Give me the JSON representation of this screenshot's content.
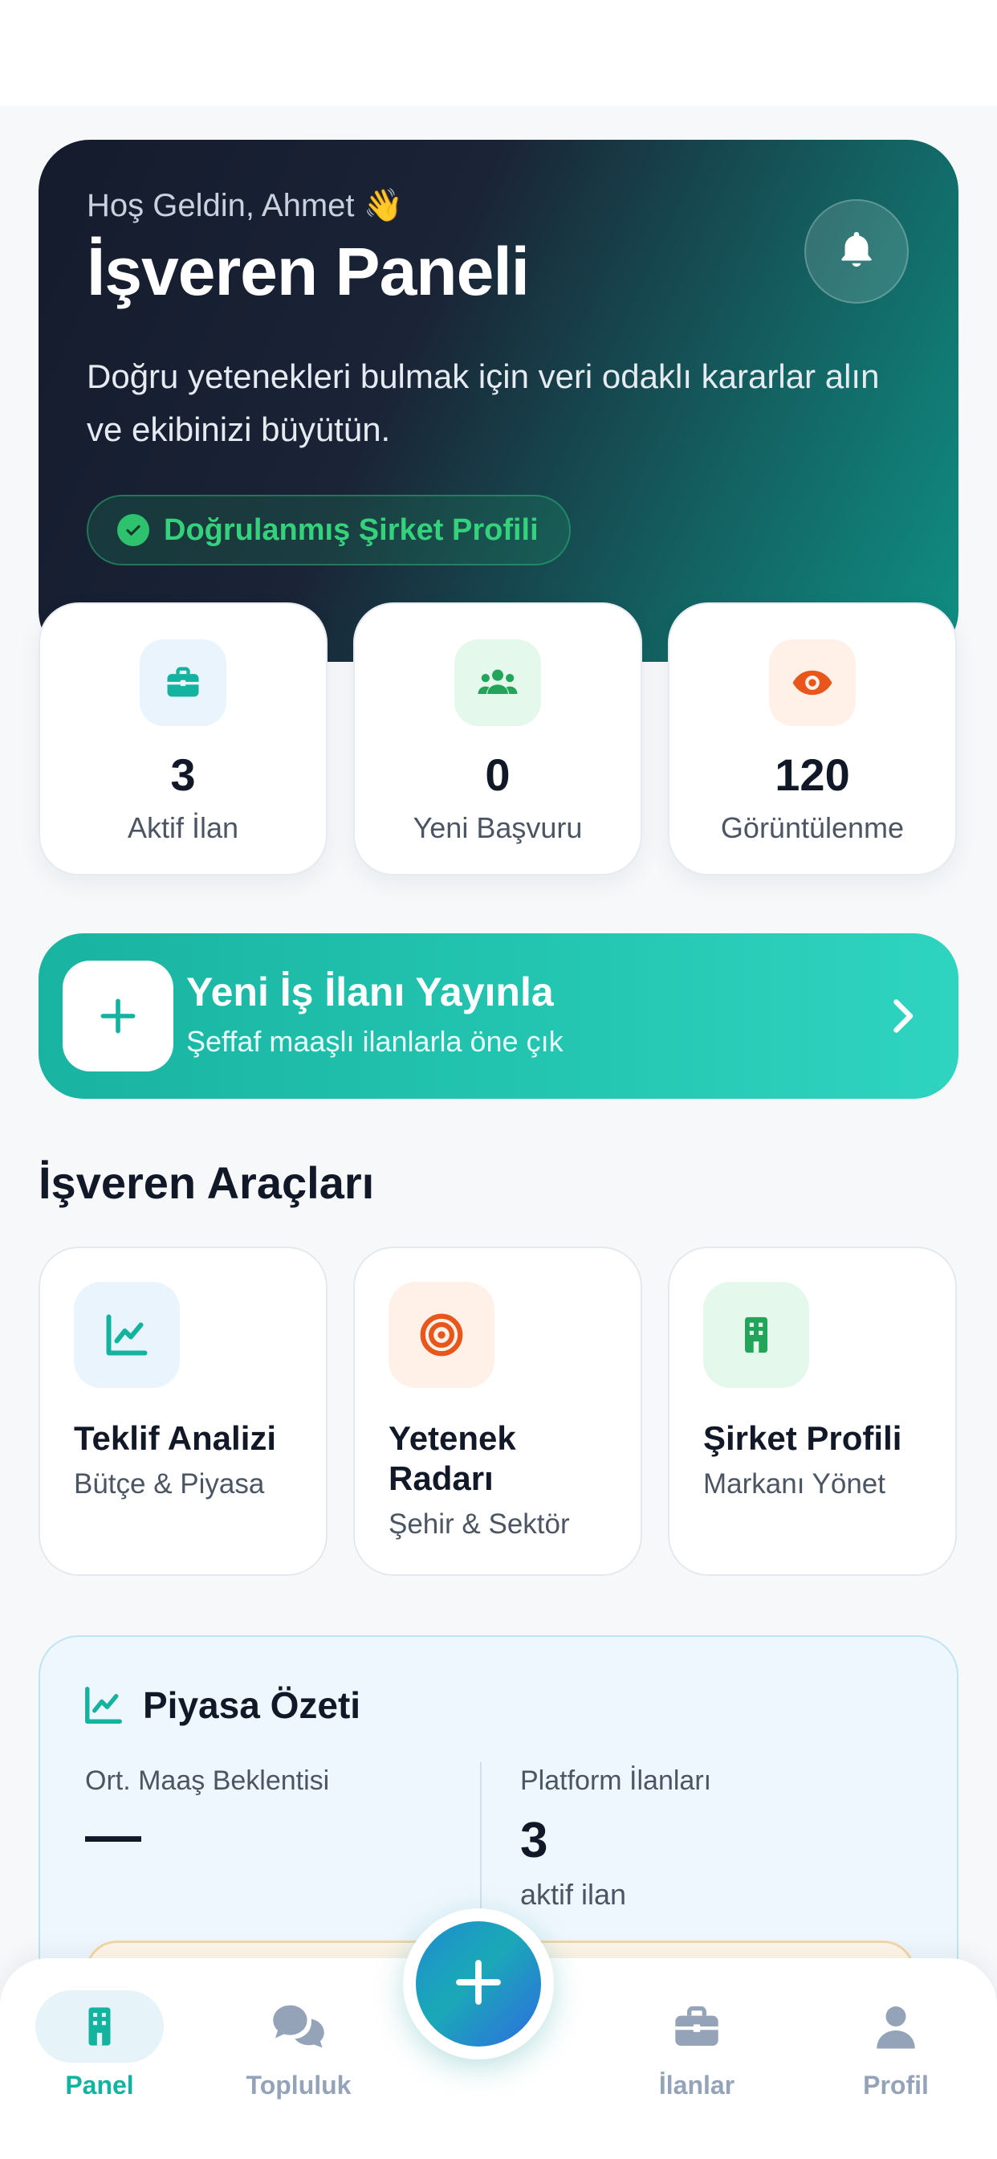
{
  "hero": {
    "greeting": "Hoş Geldin, Ahmet 👋",
    "title": "İşveren Paneli",
    "description": "Doğru yetenekleri bulmak için veri odaklı kararlar alın ve ekibinizi büyütün.",
    "verified_badge": "Doğrulanmış Şirket Profili"
  },
  "stats": [
    {
      "value": "3",
      "label": "Aktif İlan",
      "icon": "briefcase-icon",
      "color": "#14b3a0"
    },
    {
      "value": "0",
      "label": "Yeni Başvuru",
      "icon": "users-icon",
      "color": "#22a55a"
    },
    {
      "value": "120",
      "label": "Görüntülenme",
      "icon": "eye-icon",
      "color": "#e8561c"
    }
  ],
  "cta": {
    "title": "Yeni İş İlanı Yayınla",
    "subtitle": "Şeffaf maaşlı ilanlarla öne çık"
  },
  "tools_section": {
    "title": "İşveren Araçları",
    "items": [
      {
        "title": "Teklif Analizi",
        "subtitle": "Bütçe & Piyasa",
        "icon": "chart-line-icon"
      },
      {
        "title": "Yetenek Radarı",
        "subtitle": "Şehir & Sektör",
        "icon": "target-icon"
      },
      {
        "title": "Şirket Profili",
        "subtitle": "Markanı Yönet",
        "icon": "building-icon"
      }
    ]
  },
  "market": {
    "title": "Piyasa Özeti",
    "salary_label": "Ort. Maaş Beklentisi",
    "salary_value": "—",
    "listings_label": "Platform İlanları",
    "listings_value": "3",
    "listings_sub": "aktif ilan"
  },
  "tabbar": {
    "items": [
      {
        "label": "Panel",
        "icon": "building-icon",
        "active": true
      },
      {
        "label": "Topluluk",
        "icon": "chat-bubbles-icon",
        "active": false
      },
      {
        "label": "İlanlar",
        "icon": "briefcase-icon",
        "active": false
      },
      {
        "label": "Profil",
        "icon": "user-icon",
        "active": false
      }
    ]
  },
  "colors": {
    "brand_teal": "#14b3a0",
    "verified_green": "#34d27b",
    "hero_dark": "#141b2d",
    "fab_blue": "#1e8bd0"
  }
}
